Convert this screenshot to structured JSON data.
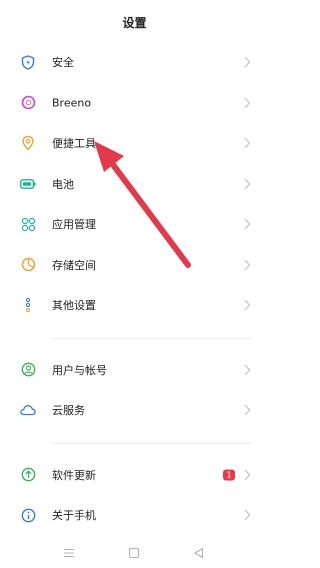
{
  "header": {
    "title": "设置"
  },
  "items": [
    {
      "label": "安全",
      "icon": "shield-icon"
    },
    {
      "label": "Breeno",
      "icon": "breeno-icon"
    },
    {
      "label": "便捷工具",
      "icon": "convenient-tools-icon"
    },
    {
      "label": "电池",
      "icon": "battery-icon"
    },
    {
      "label": "应用管理",
      "icon": "app-management-icon"
    },
    {
      "label": "存储空间",
      "icon": "storage-icon"
    },
    {
      "label": "其他设置",
      "icon": "more-settings-icon"
    },
    {
      "label": "用户与帐号",
      "icon": "user-account-icon"
    },
    {
      "label": "云服务",
      "icon": "cloud-icon"
    },
    {
      "label": "软件更新",
      "icon": "software-update-icon",
      "badge": "1"
    },
    {
      "label": "关于手机",
      "icon": "about-phone-icon"
    }
  ],
  "colors": {
    "shield": "#3a7bd5",
    "breeno": "#c04bd6",
    "tools": "#f2a33c",
    "battery": "#19b38a",
    "apps": "#2fb3a8",
    "storage": "#f2a33c",
    "more": "#3a7bd5",
    "user": "#3fb05a",
    "cloud": "#3a7bd5",
    "update": "#3fb05a",
    "about": "#3a7bd5",
    "badge": "#e8394a",
    "annotation_arrow": "#e23a4b"
  },
  "navbar": {
    "buttons": [
      "menu-icon",
      "home-icon",
      "back-icon"
    ]
  }
}
